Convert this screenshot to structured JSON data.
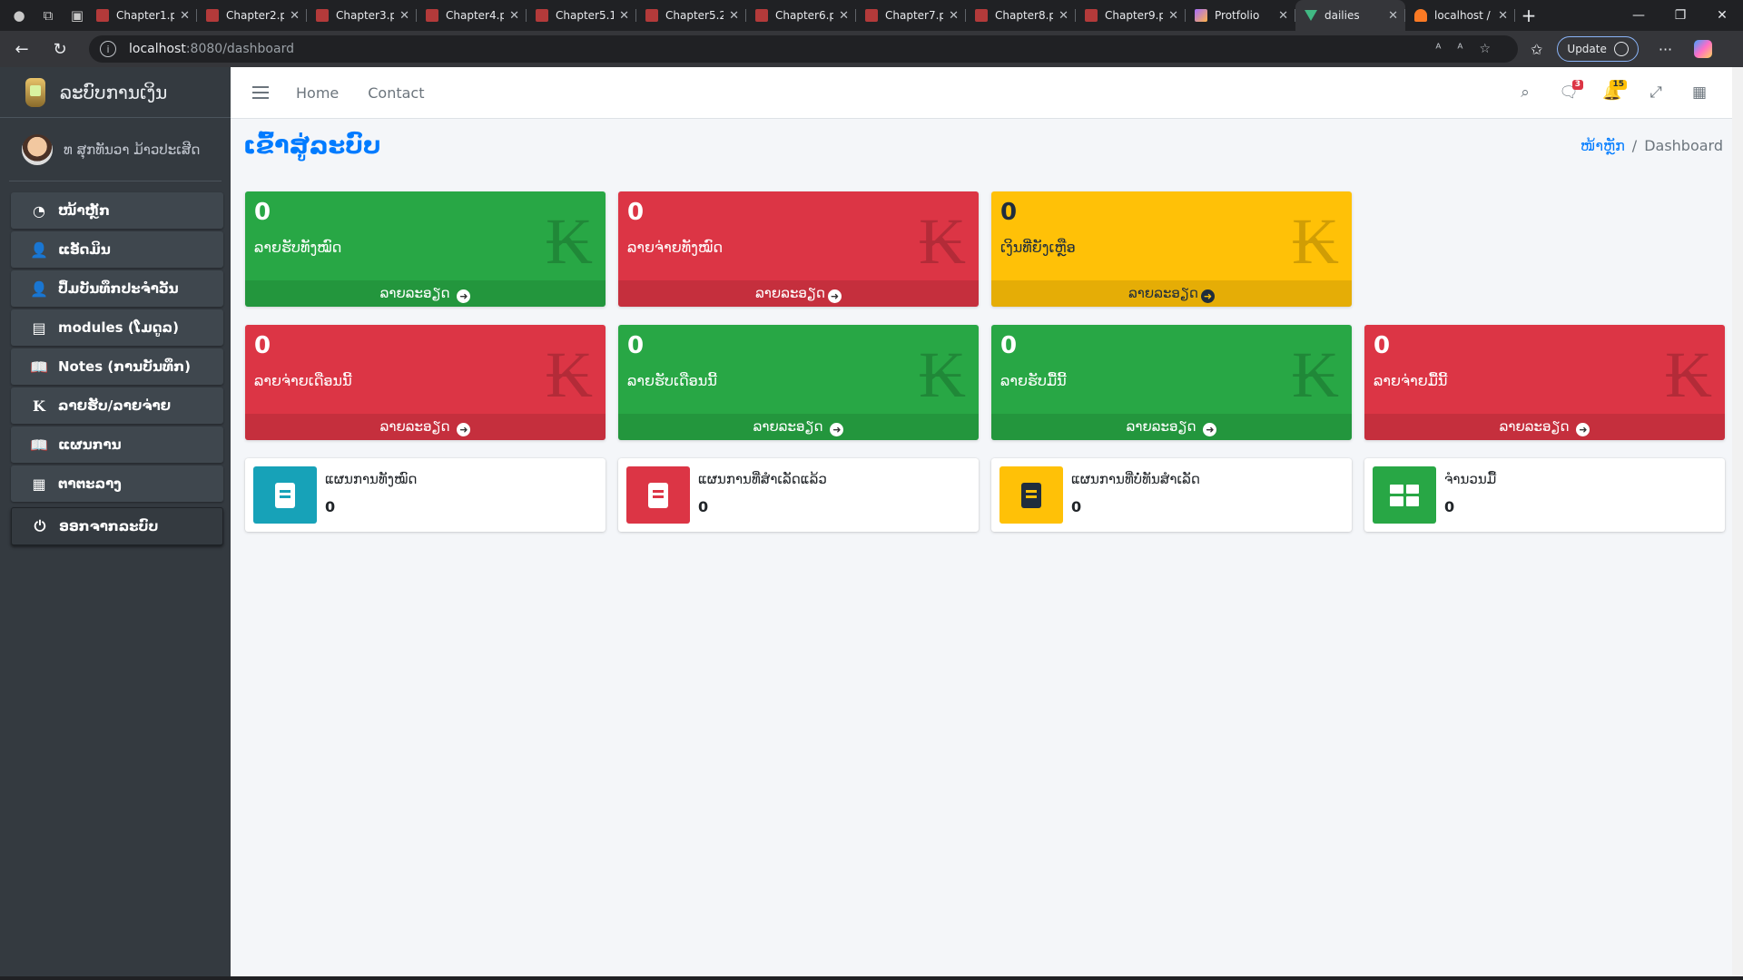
{
  "browser": {
    "tabs": [
      {
        "title": "Chapter1.p",
        "type": "pdf"
      },
      {
        "title": "Chapter2.p",
        "type": "pdf"
      },
      {
        "title": "Chapter3.p",
        "type": "pdf"
      },
      {
        "title": "Chapter4.p",
        "type": "pdf"
      },
      {
        "title": "Chapter5.1",
        "type": "pdf"
      },
      {
        "title": "Chapter5.2",
        "type": "pdf"
      },
      {
        "title": "Chapter6.p",
        "type": "pdf"
      },
      {
        "title": "Chapter7.p",
        "type": "pdf"
      },
      {
        "title": "Chapter8.p",
        "type": "pdf"
      },
      {
        "title": "Chapter9.p",
        "type": "pdf"
      },
      {
        "title": "Protfolio",
        "type": "pp"
      },
      {
        "title": "dailies",
        "type": "vue",
        "active": true
      },
      {
        "title": "localhost /",
        "type": "xampp"
      }
    ],
    "url_host": "localhost",
    "url_path": ":8080/dashboard",
    "update_label": "Update"
  },
  "sidebar": {
    "brand": "ລະບົບການເງິນ",
    "user": "ທ ສຸກທັນວາ ມ້າວປະເສີດ",
    "items": [
      {
        "label": "ໜ້າຫຼັກ",
        "icon": "dashboard-icon"
      },
      {
        "label": "ແອັດມິນ",
        "icon": "user-icon"
      },
      {
        "label": "ປຶ້ມບັນທຶກປະຈໍາວັນ",
        "icon": "user-icon"
      },
      {
        "label": "modules (ໂມດູລ)",
        "icon": "book-icon"
      },
      {
        "label": "Notes (ການບັນທຶກ)",
        "icon": "open-book-icon"
      },
      {
        "label": "ລາຍຮັບ/ລາຍຈ່າຍ",
        "icon": "kip-icon"
      },
      {
        "label": "ແຜນການ",
        "icon": "open-book-icon"
      },
      {
        "label": "ຕາຕະລາງ",
        "icon": "table-icon"
      },
      {
        "label": "ອອກຈາກລະບົບ",
        "icon": "power-icon"
      }
    ]
  },
  "topnav": {
    "home": "Home",
    "contact": "Contact",
    "messages_count": "3",
    "notifications_count": "15"
  },
  "content": {
    "title": "ເຂົ້າສູ່ລະບົບ",
    "breadcrumb_home": "ໜ້າຫຼັກ",
    "breadcrumb_current": "Dashboard",
    "more_info": "ລາຍລະອຽດ",
    "kip_symbol": "₭",
    "stat_boxes": [
      {
        "value": "0",
        "label": "ລາຍຮັບທັງໝົດ",
        "color": "#28a745"
      },
      {
        "value": "0",
        "label": "ລາຍຈ່າຍທັງໝົດ",
        "color": "#dc3545"
      },
      {
        "value": "0",
        "label": "ເງິນທີ່ຍັງເຫຼືອ",
        "color": "#ffc107"
      },
      {
        "value": "0",
        "label": "ລາຍຈ່າຍເດືອນນີ້",
        "color": "#dc3545"
      },
      {
        "value": "0",
        "label": "ລາຍຮັບເດືອນນີ້",
        "color": "#28a745"
      },
      {
        "value": "0",
        "label": "ລາຍຮັບມື້ນີ້",
        "color": "#28a745"
      },
      {
        "value": "0",
        "label": "ລາຍຈ່າຍມື້ນີ້",
        "color": "#dc3545"
      }
    ],
    "info_boxes": [
      {
        "label": "ແຜນການທັງໝົດ",
        "value": "0",
        "color": "#17a2b8"
      },
      {
        "label": "ແຜນການທີ່ສຳເລັດແລ້ວ",
        "value": "0",
        "color": "#dc3545"
      },
      {
        "label": "ແຜນການທີ່ບໍ່ທັນສຳເລັດ",
        "value": "0",
        "color": "#ffc107"
      },
      {
        "label": "ຈຳນວນມື້",
        "value": "0",
        "color": "#28a745"
      }
    ]
  }
}
